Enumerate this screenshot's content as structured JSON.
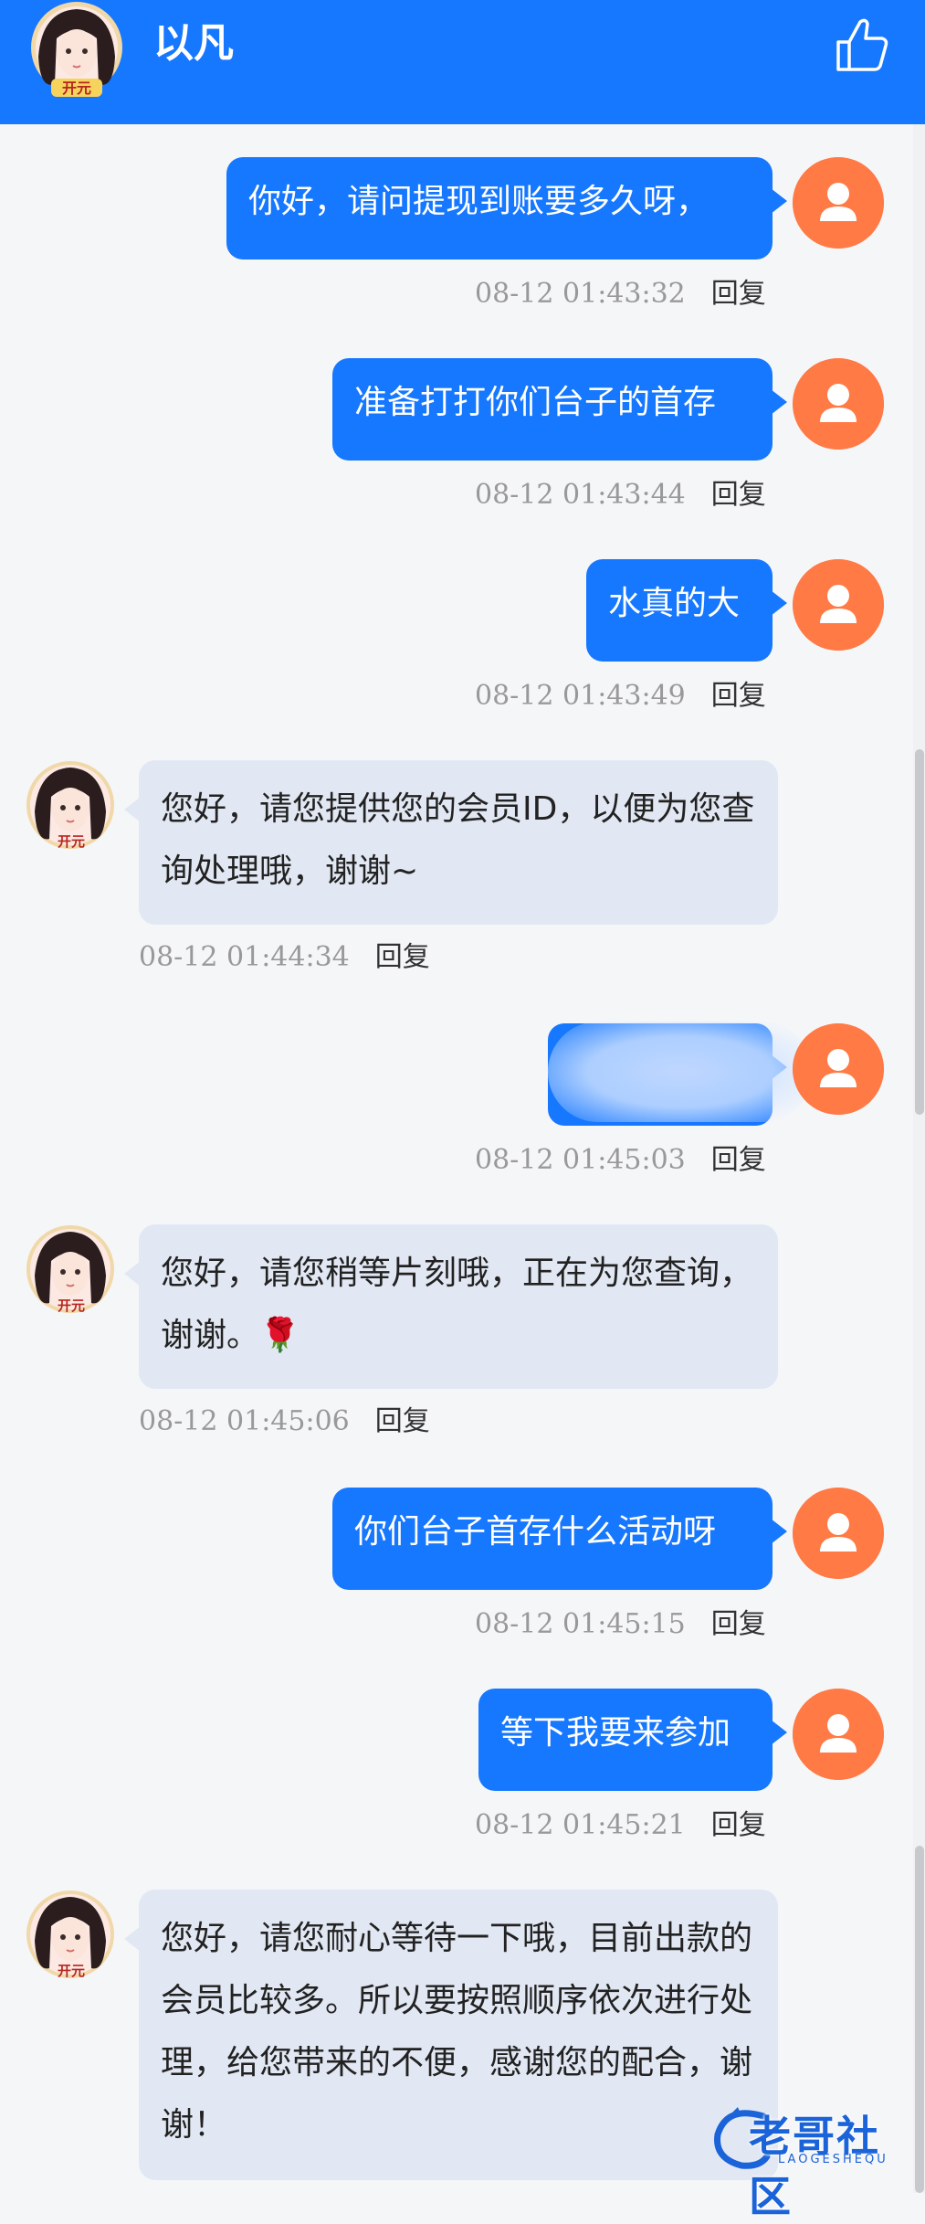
{
  "header": {
    "title": "以凡",
    "avatar_badge": "开元"
  },
  "messages": [
    {
      "side": "out",
      "text": "你好，请问提现到账要多久呀，",
      "time": "08-12 01:43:32",
      "reply": "回复"
    },
    {
      "side": "out",
      "text": "准备打打你们台子的首存",
      "time": "08-12 01:43:44",
      "reply": "回复"
    },
    {
      "side": "out",
      "text": "水真的大",
      "time": "08-12 01:43:49",
      "reply": "回复"
    },
    {
      "side": "in",
      "text": "您好，请您提供您的会员ID，以便为您查询处理哦，谢谢~",
      "time": "08-12 01:44:34",
      "reply": "回复",
      "badge": "开元"
    },
    {
      "side": "out",
      "text": "",
      "time": "08-12 01:45:03",
      "reply": "回复"
    },
    {
      "side": "in",
      "text": "您好，请您稍等片刻哦，正在为您查询，谢谢。🌹",
      "time": "08-12 01:45:06",
      "reply": "回复",
      "badge": "开元"
    },
    {
      "side": "out",
      "text": "你们台子首存什么活动呀",
      "time": "08-12 01:45:15",
      "reply": "回复"
    },
    {
      "side": "out",
      "text": "等下我要来参加",
      "time": "08-12 01:45:21",
      "reply": "回复"
    },
    {
      "side": "in",
      "text": "您好，请您耐心等待一下哦，目前出款的会员比较多。所以要按照顺序依次进行处理，给您带来的不便，感谢您的配合，谢谢！",
      "time": "",
      "reply": "",
      "badge": "开元"
    }
  ],
  "watermark": {
    "text": "老哥社区",
    "sub": "LAOGESHEQU"
  },
  "colors": {
    "header": "#1677ff",
    "out_bubble": "#1677ff",
    "in_bubble": "#e2e8f3",
    "user_avatar": "#ff7a45"
  }
}
